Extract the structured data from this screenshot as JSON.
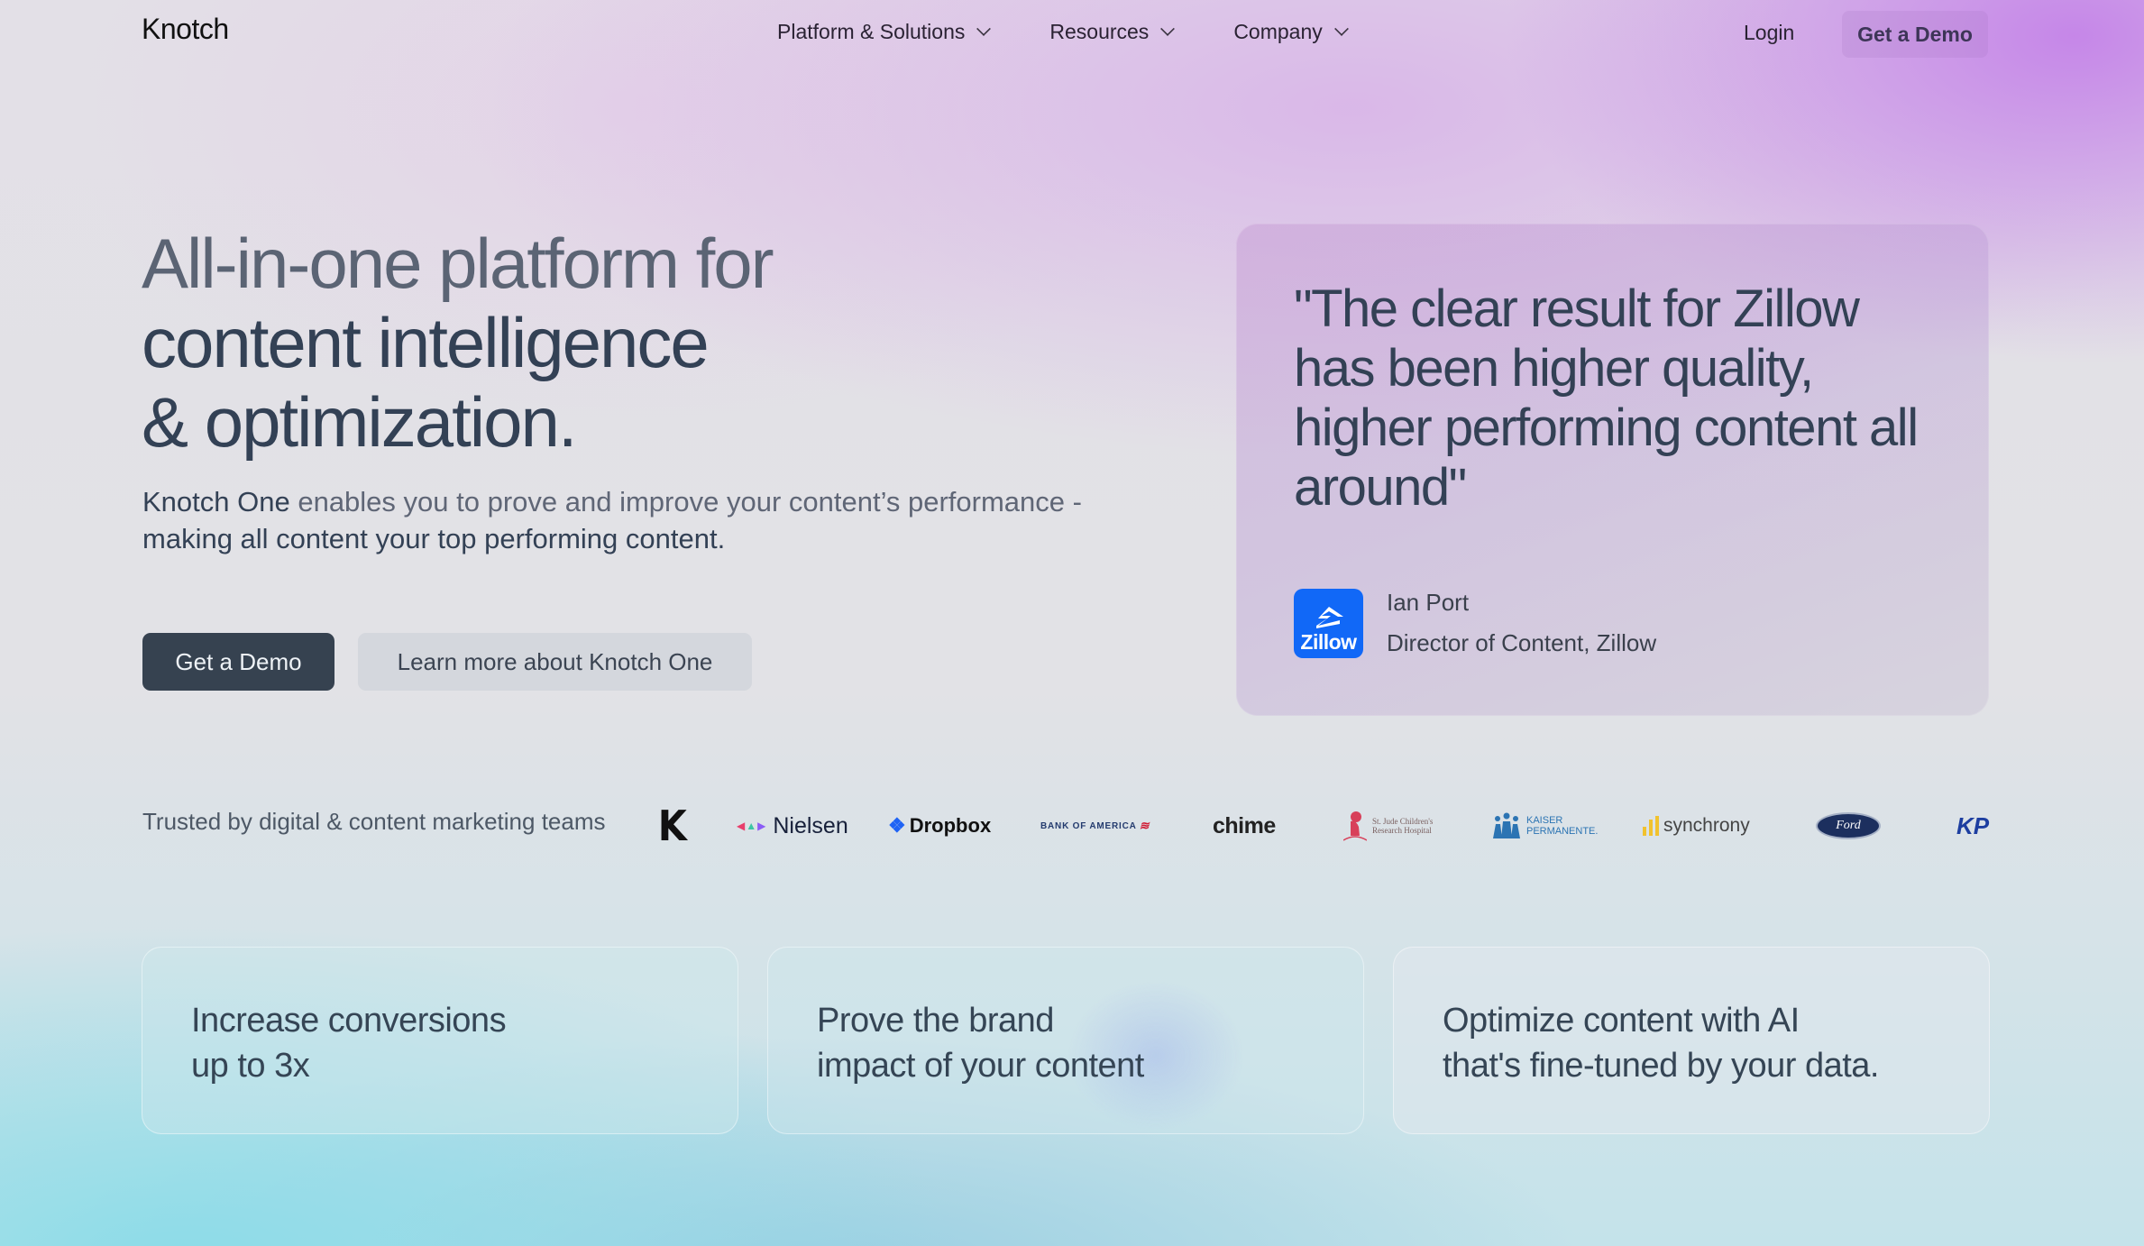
{
  "nav": {
    "logo": "Knotch",
    "links": [
      {
        "label": "Platform & Solutions",
        "icon": "chevron-down-icon"
      },
      {
        "label": "Resources",
        "icon": "chevron-down-icon"
      },
      {
        "label": "Company",
        "icon": "chevron-down-icon"
      }
    ],
    "login": "Login",
    "cta": "Get a Demo"
  },
  "hero": {
    "title_lines": [
      "All-in-one platform for",
      "content intelligence",
      "& optimization."
    ],
    "subtitle_strong": "Knotch One",
    "subtitle_muted": " enables you to prove and improve your content’s performance - ",
    "subtitle_rest": "making all content your top performing content.",
    "primary_button": "Get a Demo",
    "secondary_button": "Learn more about Knotch One"
  },
  "testimonial": {
    "quote": "\"The clear result for Zillow has been higher quality, higher performing content all around\"",
    "logo_text": "Zillow",
    "author_name": "Ian Port",
    "author_role": "Director of Content, Zillow",
    "logo_color": "#1168f7"
  },
  "trusted": {
    "label": "Trusted by digital & content marketing teams",
    "logos": {
      "k": "K",
      "nielsen": "Nielsen",
      "dropbox": "Dropbox",
      "boa": "BANK OF AMERICA",
      "chime": "chime",
      "stjude_line1": "St. Jude Children's",
      "stjude_line2": "Research Hospital",
      "kaiser_line1": "KAISER",
      "kaiser_line2": "PERMANENTE.",
      "synchrony": "synchrony",
      "ford": "Ford",
      "kp": "KP"
    }
  },
  "features": [
    {
      "line1": "Increase conversions",
      "line2": "up to 3x"
    },
    {
      "line1": "Prove the brand",
      "line2": "impact of your content"
    },
    {
      "line1": "Optimize content with AI",
      "line2": "that's fine-tuned by your data."
    }
  ],
  "colors": {
    "primary_button": "#364250",
    "text": "#334155",
    "accent_purple": "#c482e8",
    "accent_teal": "#8cdce8"
  }
}
